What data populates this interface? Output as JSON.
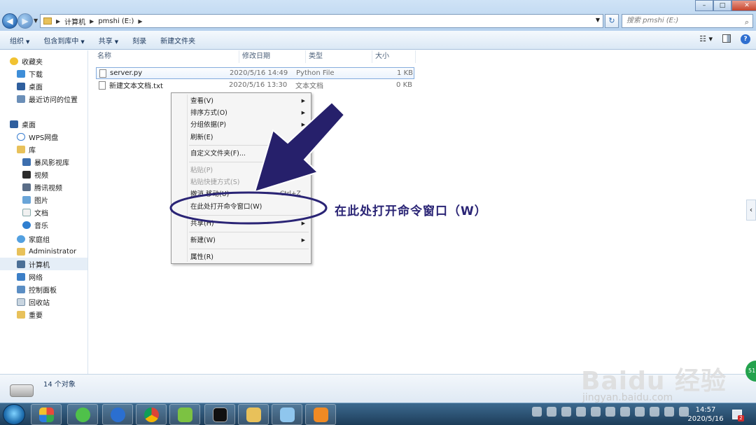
{
  "address_bar": {
    "path": [
      "计算机",
      "pmshi (E:)"
    ]
  },
  "search": {
    "placeholder": "搜索 pmshi (E:)"
  },
  "toolbar": {
    "items": [
      "组织",
      "包含到库中",
      "共享",
      "刻录",
      "新建文件夹"
    ]
  },
  "nav": {
    "favorites_header": "收藏夹",
    "favorites": [
      "下载",
      "桌面",
      "最近访问的位置"
    ],
    "desktop_header": "桌面",
    "tree": [
      "WPS网盘",
      "库"
    ],
    "library": [
      "暴风影视库",
      "视频",
      "腾讯视频",
      "图片",
      "文档",
      "音乐"
    ],
    "others": [
      "家庭组",
      "Administrator",
      "计算机",
      "网络",
      "控制面板",
      "回收站",
      "重要"
    ]
  },
  "columns": [
    "名称",
    "修改日期",
    "类型",
    "大小"
  ],
  "files": [
    {
      "name": "server.py",
      "date": "2020/5/16 14:49",
      "type": "Python File",
      "size": "1 KB"
    },
    {
      "name": "新建文本文档.txt",
      "date": "2020/5/16 13:30",
      "type": "文本文档",
      "size": "0 KB"
    }
  ],
  "context_menu": {
    "items": [
      {
        "label": "查看(V)",
        "submenu": true,
        "disabled": false
      },
      {
        "label": "排序方式(O)",
        "submenu": true,
        "disabled": false
      },
      {
        "label": "分组依据(P)",
        "submenu": true,
        "disabled": false
      },
      {
        "label": "刷新(E)",
        "submenu": false,
        "disabled": false
      },
      {
        "label": "自定义文件夹(F)...",
        "submenu": false,
        "disabled": false
      },
      {
        "label": "粘贴(P)",
        "submenu": false,
        "disabled": true
      },
      {
        "label": "粘贴快捷方式(S)",
        "submenu": false,
        "disabled": true
      },
      {
        "label": "撤消 移动(U)",
        "submenu": false,
        "disabled": false
      },
      {
        "label": "在此处打开命令窗口(W)",
        "submenu": false,
        "disabled": false
      },
      {
        "label": "共享(H)",
        "submenu": true,
        "disabled": false
      },
      {
        "label": "新建(W)",
        "submenu": true,
        "disabled": false
      },
      {
        "label": "属性(R)",
        "submenu": false,
        "disabled": false
      }
    ],
    "undo_shortcut": "Ctrl+Z"
  },
  "annotation": {
    "text": "在此处打开命令窗口（W）"
  },
  "details": {
    "object_count": "14 个对象"
  },
  "watermark": {
    "text": "Baidu 经验",
    "url": "jingyan.baidu.com"
  },
  "side_badge": "51",
  "taskbar": {
    "time": "14:57",
    "date": "2020/5/16",
    "notification_count": "2"
  },
  "colors": {
    "annotation": "#2a2475",
    "selection": "#e5eef7",
    "taskbar": "#1d3d5a"
  }
}
